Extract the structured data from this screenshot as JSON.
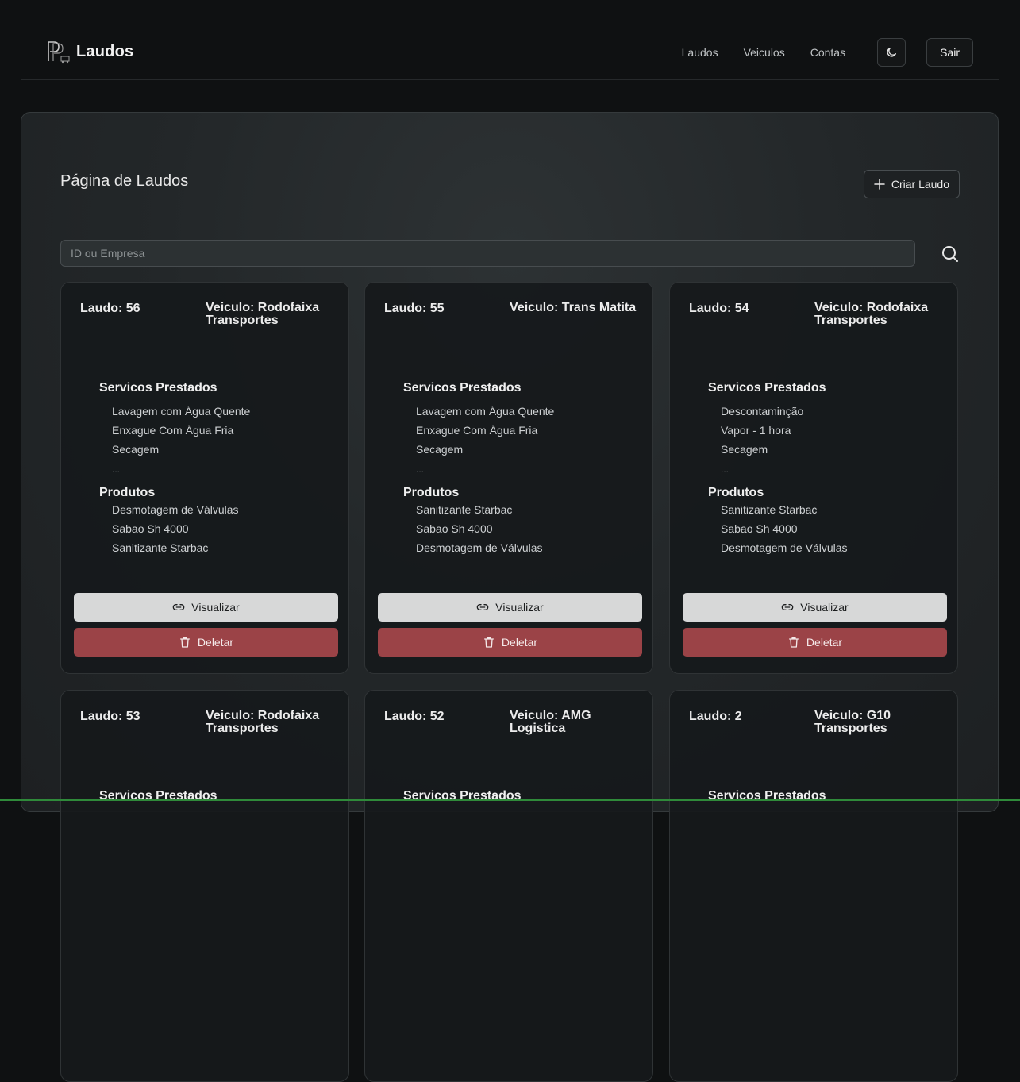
{
  "header": {
    "brand_title": "Laudos",
    "nav": [
      "Laudos",
      "Veiculos",
      "Contas"
    ],
    "logout_label": "Sair"
  },
  "main": {
    "page_title": "Página de Laudos",
    "create_label": "Criar Laudo",
    "search": {
      "placeholder": "ID ou Empresa",
      "value": ""
    }
  },
  "labels": {
    "services_heading": "Servicos Prestados",
    "products_heading": "Produtos",
    "view_label": "Visualizar",
    "delete_label": "Deletar",
    "more": "..."
  },
  "cards": [
    {
      "id_label": "Laudo: 56",
      "vehicle_label": "Veiculo: Rodofaixa Transportes",
      "services": [
        "Lavagem com Água Quente",
        "Enxague Com Água Fria",
        "Secagem"
      ],
      "products": [
        "Desmotagem de Válvulas",
        "Sabao Sh 4000",
        "Sanitizante Starbac"
      ]
    },
    {
      "id_label": "Laudo: 55",
      "vehicle_label": "Veiculo: Trans Matita",
      "services": [
        "Lavagem com Água Quente",
        "Enxague Com Água Fria",
        "Secagem"
      ],
      "products": [
        "Sanitizante Starbac",
        "Sabao Sh 4000",
        "Desmotagem de Válvulas"
      ]
    },
    {
      "id_label": "Laudo: 54",
      "vehicle_label": "Veiculo: Rodofaixa Transportes",
      "services": [
        "Descontaminção",
        "Vapor  - 1 hora",
        "Secagem"
      ],
      "products": [
        "Sanitizante Starbac",
        "Sabao Sh 4000",
        "Desmotagem de Válvulas"
      ]
    },
    {
      "id_label": "Laudo: 53",
      "vehicle_label": "Veiculo: Rodofaixa Transportes",
      "services": [],
      "products": []
    },
    {
      "id_label": "Laudo: 52",
      "vehicle_label": "Veiculo: AMG Logistica",
      "services": [],
      "products": []
    },
    {
      "id_label": "Laudo: 2",
      "vehicle_label": "Veiculo: G10 Transportes",
      "services": [],
      "products": []
    }
  ]
}
